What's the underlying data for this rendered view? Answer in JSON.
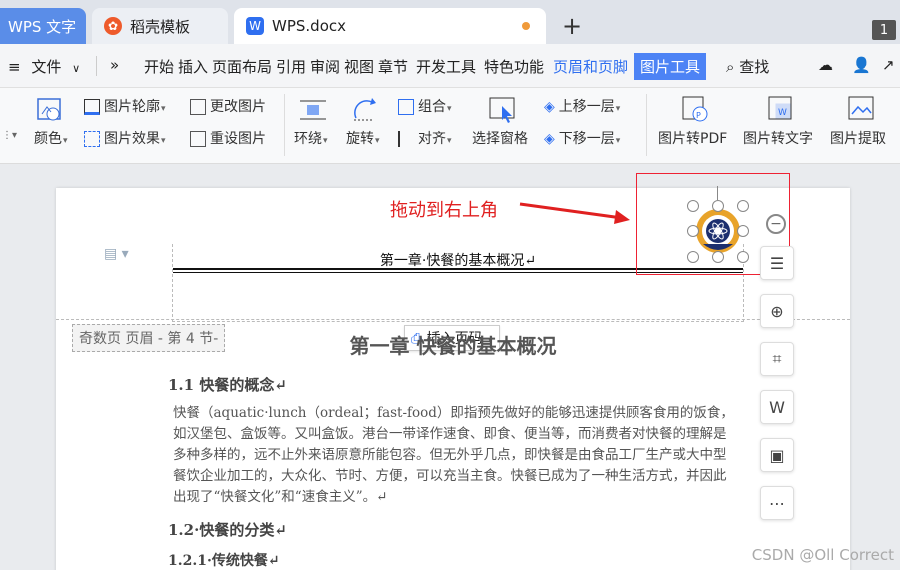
{
  "tabs": {
    "wps": "WPS 文字",
    "daoke": "稻壳模板",
    "doc": "WPS.docx",
    "count_badge": "1"
  },
  "menu": {
    "file": "文件",
    "items": [
      "开始",
      "插入",
      "页面布局",
      "引用",
      "审阅",
      "视图",
      "章节",
      "开发工具",
      "特色功能",
      "页眉和页脚",
      "图片工具"
    ],
    "search": "查找"
  },
  "ribbon": {
    "color": "颜色",
    "outline": "图片轮廓",
    "effect": "图片效果",
    "change": "更改图片",
    "reset": "重设图片",
    "wrap": "环绕",
    "rotate": "旋转",
    "group": "组合",
    "align": "对齐",
    "selection_pane": "选择窗格",
    "bring_forward": "上移一层",
    "send_backward": "下移一层",
    "to_pdf": "图片转PDF",
    "to_text": "图片转文字",
    "extract": "图片提取"
  },
  "document": {
    "header_text": "第一章·快餐的基本概况↵",
    "section_label": "奇数页 页眉  - 第 4 节-",
    "insert_page_number": "插入页码",
    "chapter_title": "第一章 快餐的基本概况",
    "h_1_1": "1.1 快餐的概念↵",
    "para_1_1": "快餐（aquatic·lunch（ordeal；fast-food）即指预先做好的能够迅速提供顾客食用的饭食，如汉堡包、盒饭等。又叫盒饭。港台一带译作速食、即食、便当等，而消费者对快餐的理解是多种多样的，远不止外来语原意所能包容。但无外乎几点，即快餐是由食品工厂生产或大中型餐饮企业加工的，大众化、节时、方便，可以充当主食。快餐已成为了一种生活方式，并因此出现了“快餐文化”和“速食主义”。↵",
    "h_1_2": "1.2·快餐的分类↵",
    "h_1_2_1": "1.2.1·传统快餐↵"
  },
  "annotation": "拖动到右上角",
  "watermark": "CSDN @Oll Correct",
  "colors": {
    "accent": "#4d83f5",
    "annotation_red": "#e02020",
    "tab_wps": "#5a8de8"
  }
}
